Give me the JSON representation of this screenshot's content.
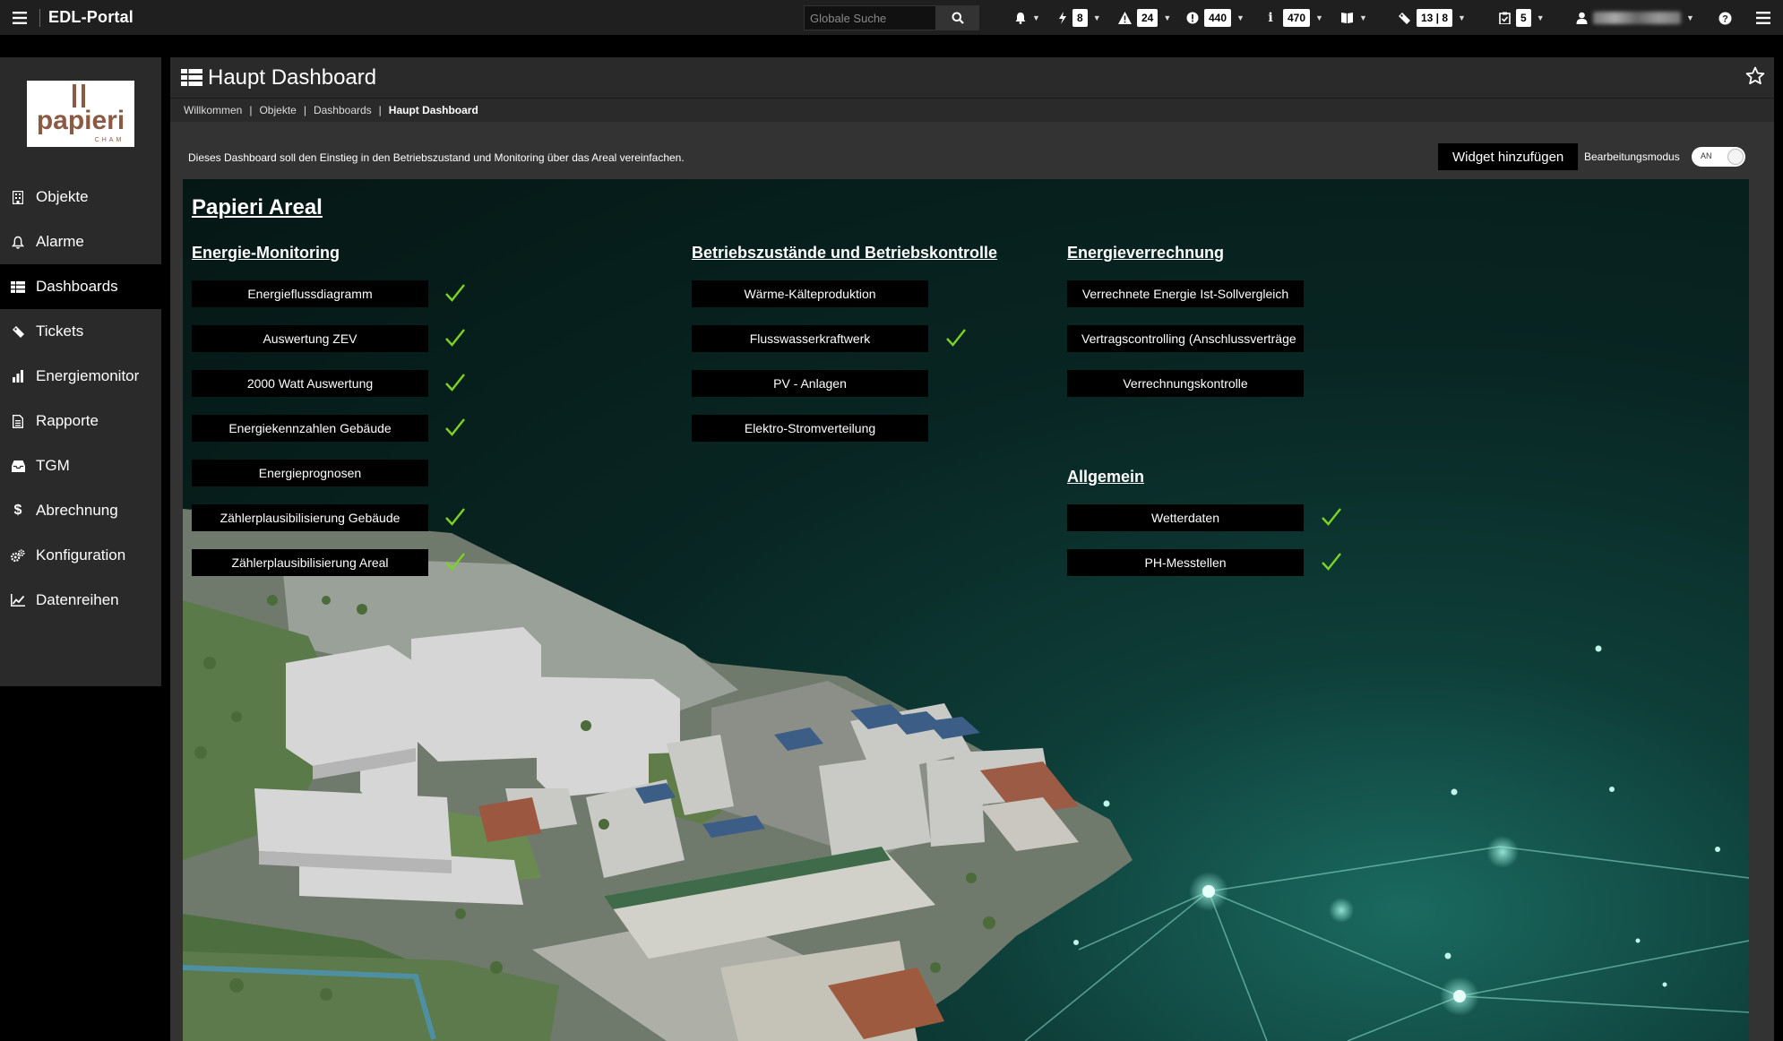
{
  "app": {
    "title": "EDL-Portal"
  },
  "search": {
    "placeholder": "Globale Suche"
  },
  "topbar": {
    "energy_count": "8",
    "warning_count": "24",
    "error_count": "440",
    "info_count": "470",
    "tickets_count": "13 | 8",
    "tasks_count": "5"
  },
  "sidebar": {
    "items": [
      {
        "label": "Objekte",
        "icon": "building-icon"
      },
      {
        "label": "Alarme",
        "icon": "bell-icon"
      },
      {
        "label": "Dashboards",
        "icon": "grid-icon"
      },
      {
        "label": "Tickets",
        "icon": "ticket-icon"
      },
      {
        "label": "Energiemonitor",
        "icon": "bar-chart-icon"
      },
      {
        "label": "Rapporte",
        "icon": "report-icon"
      },
      {
        "label": "TGM",
        "icon": "inbox-icon"
      },
      {
        "label": "Abrechnung",
        "icon": "dollar-icon"
      },
      {
        "label": "Konfiguration",
        "icon": "gears-icon"
      },
      {
        "label": "Datenreihen",
        "icon": "line-chart-icon"
      }
    ],
    "active": "Dashboards",
    "logo": {
      "text": "papieri",
      "sub": "CHAM"
    }
  },
  "page": {
    "title": "Haupt Dashboard",
    "breadcrumbs": [
      "Willkommen",
      "Objekte",
      "Dashboards",
      "Haupt Dashboard"
    ],
    "description": "Dieses Dashboard soll den Einstieg in den Betriebszustand und Monitoring über das Areal vereinfachen.",
    "add_widget_label": "Widget hinzufügen",
    "edit_mode_label": "Bearbeitungsmodus",
    "edit_mode_state": "AN"
  },
  "dashboard": {
    "heading": "Papieri Areal",
    "sections": {
      "energy_monitoring": {
        "title": "Energie-Monitoring",
        "items": [
          {
            "label": "Energieflussdiagramm",
            "ok": true
          },
          {
            "label": "Auswertung ZEV",
            "ok": true
          },
          {
            "label": "2000 Watt Auswertung",
            "ok": true
          },
          {
            "label": "Energiekennzahlen Gebäude",
            "ok": true
          },
          {
            "label": "Energieprognosen",
            "ok": false
          },
          {
            "label": "Zählerplausibilisierung Gebäude",
            "ok": true
          },
          {
            "label": "Zählerplausibilisierung Areal",
            "ok": true
          }
        ]
      },
      "operations": {
        "title": "Betriebszustände und Betriebskontrolle",
        "items": [
          {
            "label": "Wärme-Kälteproduktion",
            "ok": false
          },
          {
            "label": "Flusswasserkraftwerk",
            "ok": true
          },
          {
            "label": "PV - Anlagen",
            "ok": false
          },
          {
            "label": "Elektro-Stromverteilung",
            "ok": false
          }
        ]
      },
      "billing": {
        "title": "Energieverrechnung",
        "items": [
          {
            "label": "Verrechnete Energie Ist-Sollvergleich",
            "ok": false
          },
          {
            "label": "Vertragscontrolling (Anschlussverträge",
            "ok": false
          },
          {
            "label": "Verrechnungskontrolle",
            "ok": false
          }
        ]
      },
      "general": {
        "title": "Allgemein",
        "items": [
          {
            "label": "Wetterdaten",
            "ok": true
          },
          {
            "label": "PH-Messtellen",
            "ok": true
          }
        ]
      }
    }
  }
}
